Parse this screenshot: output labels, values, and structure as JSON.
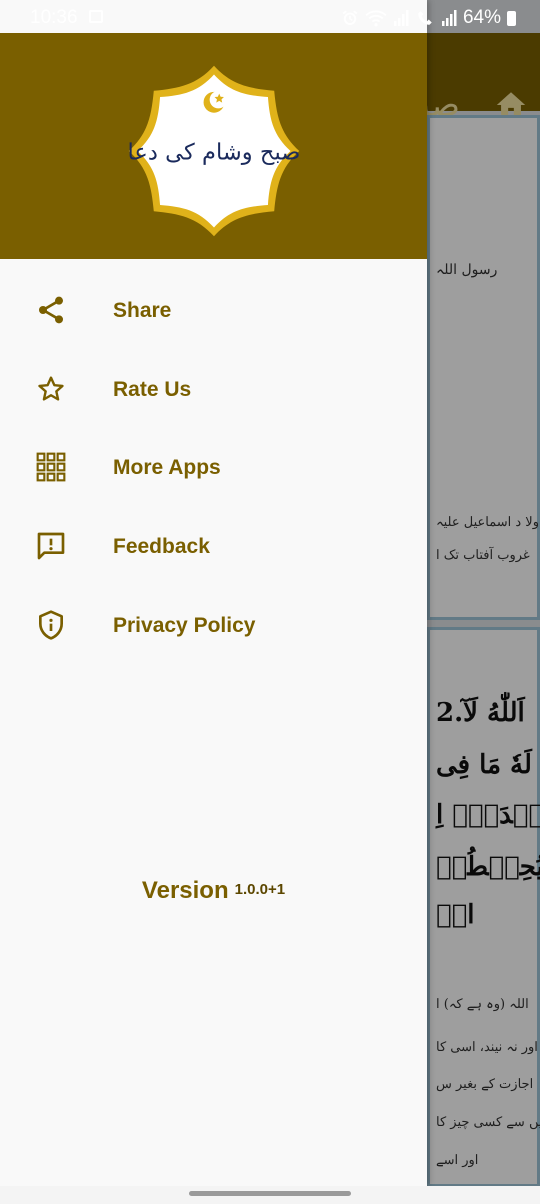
{
  "status_bar": {
    "time": "10:36",
    "battery": "64%"
  },
  "background_app": {
    "title_fragment": "صب",
    "card1_lines": [
      "رسول اللہ",
      "کہنا اولا د اسماعیل علیہ",
      "غروب آفتاب تک ا"
    ],
    "card2_arabic_lines": [
      "2.اَللّٰهُ لَآ",
      "لَهٗ مَا فِی",
      "عِنۡدَهٗۤ اِ",
      "یُحِیۡطُوۡ",
      "الۡ"
    ],
    "card2_urdu_lines": [
      "اللہ (وہ ہے کہ) ا",
      "اور نہ نیند، اسی کا",
      "اجازت کے بغیر س",
      "میں سے کسی چیز کا",
      "اور اسے"
    ]
  },
  "drawer": {
    "logo_text": "صبح وشام کی دعا",
    "menu_items": [
      {
        "label": "Share",
        "icon": "share-icon"
      },
      {
        "label": "Rate Us",
        "icon": "star-icon"
      },
      {
        "label": "More Apps",
        "icon": "apps-grid-icon"
      },
      {
        "label": "Feedback",
        "icon": "feedback-icon"
      },
      {
        "label": "Privacy Policy",
        "icon": "privacy-shield-icon"
      }
    ],
    "version_label": "Version",
    "version_number": "1.0.0+1"
  },
  "colors": {
    "brand": "#7a5f00",
    "logo_gold": "#e0b21a",
    "drawer_bg": "#f9f9f9"
  }
}
